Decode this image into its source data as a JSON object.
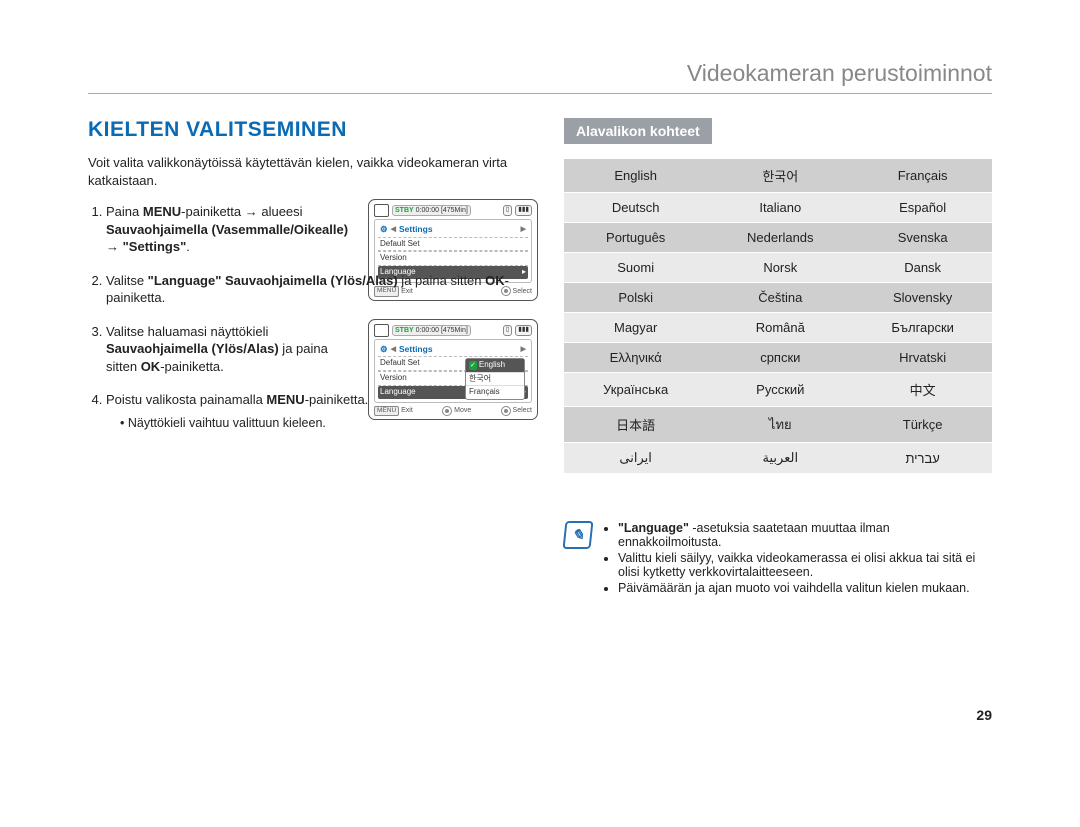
{
  "header": {
    "breadcrumb": "Videokameran perustoiminnot"
  },
  "section": {
    "title": "KIELTEN VALITSEMINEN",
    "intro": "Voit valita valikkonäytöissä käytettävän kielen, vaikka videokameran virta katkaistaan."
  },
  "steps": [
    {
      "n": "1.",
      "html": "Paina <b>MENU</b>-painiketta → alueesi <b>Sauvaohjaimella (Vasemmalle/Oikealle)</b> → <b>\"Settings\"</b>."
    },
    {
      "n": "2.",
      "html": "Valitse <b>\"Language\" Sauvaohjaimella (Ylös/Alas)</b> ja paina sitten <b>OK</b>-painiketta."
    },
    {
      "n": "3.",
      "html": "Valitse haluamasi näyttökieli <b>Sauvaohjaimella (Ylös/Alas)</b> ja paina sitten <b>OK</b>-painiketta."
    },
    {
      "n": "4.",
      "html": "Poistu valikosta painamalla <b>MENU</b>-painiketta.",
      "bullet": "Näyttökieli vaihtuu valittuun kieleen."
    }
  ],
  "ss": {
    "stby": "STBY",
    "time": "0:00:00",
    "remain": "[475Min]",
    "settings": "Settings",
    "rows": [
      "Default Set",
      "Version",
      "Language"
    ],
    "exit": "Exit",
    "select": "Select",
    "move": "Move",
    "menu": "MENU",
    "popup": [
      "English",
      "한국어",
      "Français"
    ]
  },
  "submenu_header": "Alavalikon kohteet",
  "languages": [
    [
      "English",
      "한국어",
      "Français"
    ],
    [
      "Deutsch",
      "Italiano",
      "Español"
    ],
    [
      "Português",
      "Nederlands",
      "Svenska"
    ],
    [
      "Suomi",
      "Norsk",
      "Dansk"
    ],
    [
      "Polski",
      "Čeština",
      "Slovensky"
    ],
    [
      "Magyar",
      "Română",
      "Български"
    ],
    [
      "Ελληνικά",
      "српски",
      "Hrvatski"
    ],
    [
      "Українська",
      "Русский",
      "中文"
    ],
    [
      "日本語",
      "ไทย",
      "Türkçe"
    ],
    [
      "ایرانی",
      "العربية",
      "עברית"
    ]
  ],
  "notes": [
    "<b>\"Language\"</b> -asetuksia saatetaan muuttaa ilman ennakkoilmoitusta.",
    "Valittu kieli säilyy, vaikka videokamerassa ei olisi akkua tai sitä ei olisi kytketty verkkovirtalaitteeseen.",
    "Päivämäärän ja ajan muoto voi vaihdella valitun kielen mukaan."
  ],
  "page_number": "29"
}
